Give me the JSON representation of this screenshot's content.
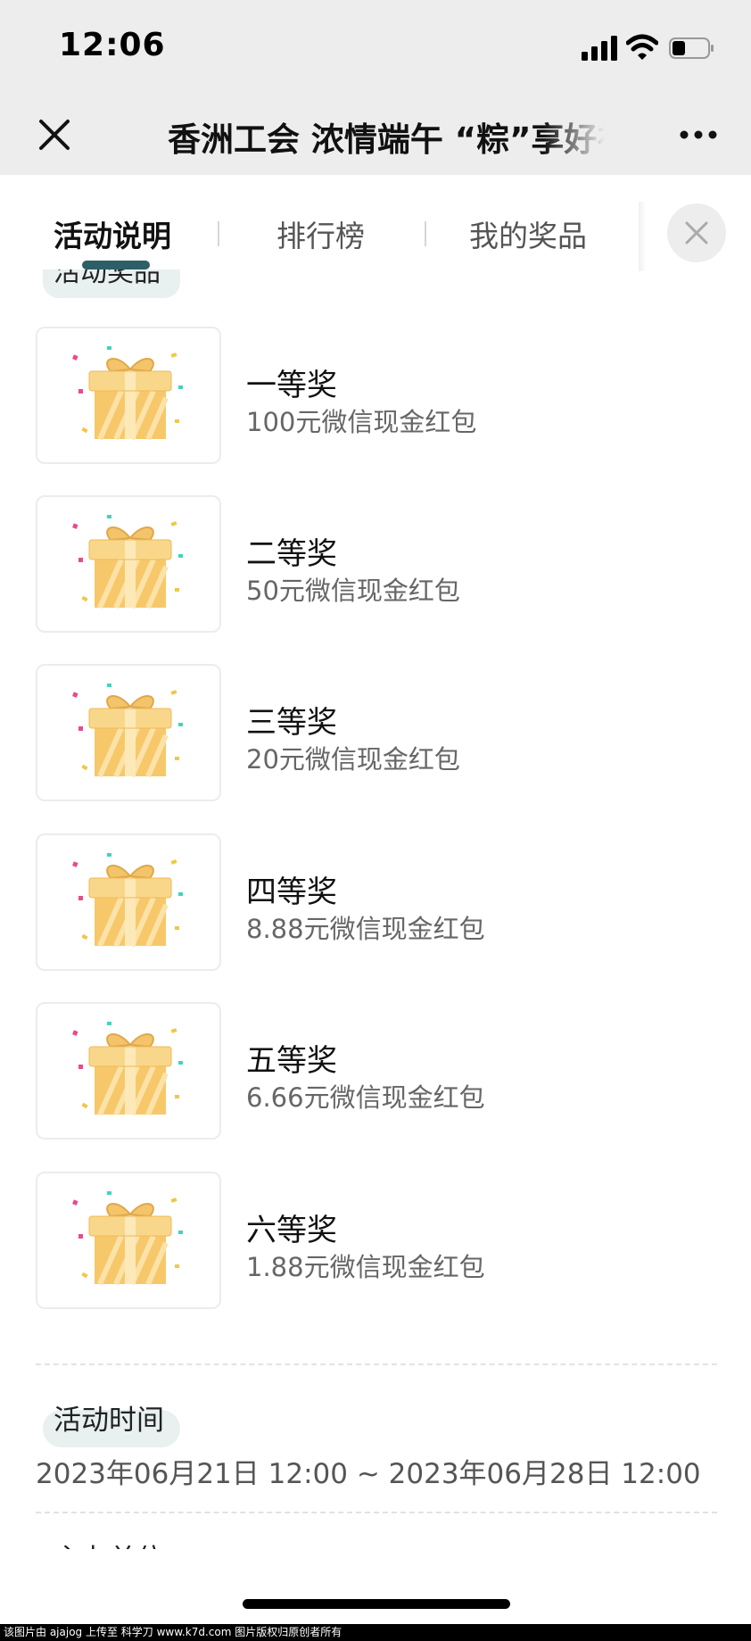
{
  "status_bar": {
    "time": "12:06"
  },
  "nav": {
    "title": "香洲工会 浓情端午 “粽”享好礼"
  },
  "tabs": [
    {
      "label": "活动说明",
      "active": true
    },
    {
      "label": "排行榜",
      "active": false
    },
    {
      "label": "我的奖品",
      "active": false
    }
  ],
  "prizes_section": {
    "label": "活动奖品"
  },
  "prizes": [
    {
      "name": "一等奖",
      "desc": "100元微信现金红包"
    },
    {
      "name": "二等奖",
      "desc": "50元微信现金红包"
    },
    {
      "name": "三等奖",
      "desc": "20元微信现金红包"
    },
    {
      "name": "四等奖",
      "desc": "8.88元微信现金红包"
    },
    {
      "name": "五等奖",
      "desc": "6.66元微信现金红包"
    },
    {
      "name": "六等奖",
      "desc": "1.88元微信现金红包"
    }
  ],
  "time_section": {
    "label": "活动时间",
    "range": "2023年06月21日 12:00 ~ 2023年06月28日 12:00"
  },
  "next_section": {
    "label": "主办单位"
  },
  "watermark": "该图片由 ajajog 上传至 科学刀 www.k7d.com 图片版权归原创者所有",
  "colors": {
    "accent": "#2d5f66",
    "label_bg": "#e8f0f0",
    "gift": "#f7c86a"
  }
}
